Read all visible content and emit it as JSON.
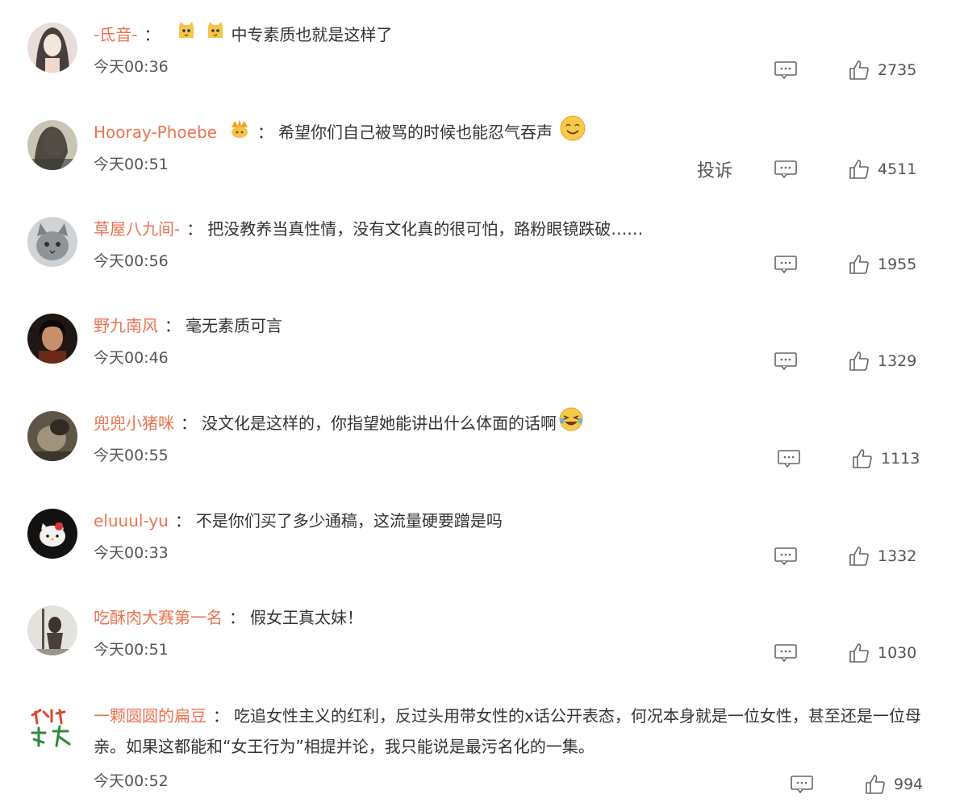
{
  "comments": [
    {
      "user": "-氐音-",
      "text": "中专素质也就是这样了",
      "time": "今天00:36",
      "likes": "2735"
    },
    {
      "user": "Hooray-Phoebe",
      "text": "希望你们自己被骂的时候也能忍气吞声",
      "time": "今天00:51",
      "likes": "4511",
      "report": "投诉"
    },
    {
      "user": "草屋八九间-",
      "text": "把没教养当真性情，没有文化真的很可怕，路粉眼镜跌破……",
      "time": "今天00:56",
      "likes": "1955"
    },
    {
      "user": "野九南风",
      "text": "毫无素质可言",
      "time": "今天00:46",
      "likes": "1329"
    },
    {
      "user": "兜兜小猪咪",
      "text": "没文化是这样的，你指望她能讲出什么体面的话啊",
      "time": "今天00:55",
      "likes": "1113"
    },
    {
      "user": "eluuul-yu",
      "text": "不是你们买了多少通稿，这流量硬要蹭是吗",
      "time": "今天00:33",
      "likes": "1332"
    },
    {
      "user": "吃酥肉大赛第一名",
      "text": "假女王真太妹！",
      "time": "今天00:51",
      "likes": "1030"
    },
    {
      "user": "一颗圆圆的扁豆",
      "text": "吃追女性主义的红利，反过头用带女性的x话公开表态，何况本身就是一位女性，甚至还是一位母亲。如果这都能和“女王行为”相提并论，我只能说是最污名化的一集。",
      "time": "今天00:52",
      "likes": "994"
    }
  ],
  "colon": "：",
  "colors": {
    "username": "#eb7350",
    "text": "#333333",
    "meta": "#555555"
  },
  "icons": {
    "reply": "comment-icon",
    "like": "thumbs-up-icon"
  }
}
